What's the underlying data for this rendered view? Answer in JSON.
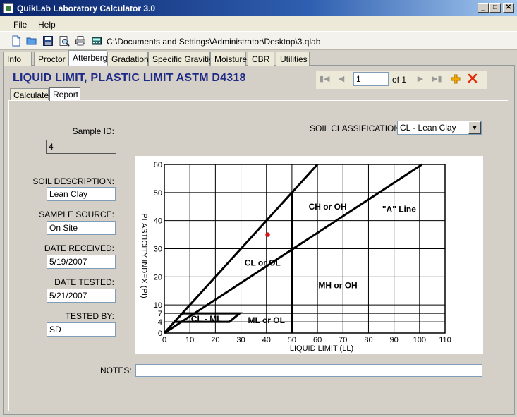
{
  "window": {
    "title": "QuikLab Laboratory Calculator 3.0",
    "minimize": "_",
    "maximize": "□",
    "close": "✕"
  },
  "menu": [
    "File",
    "Help"
  ],
  "toolbar": {
    "icons": [
      "new-file-icon",
      "open-folder-icon",
      "save-icon",
      "print-preview-icon",
      "print-icon",
      "calculator-icon"
    ],
    "file_path": "C:\\Documents and Settings\\Administrator\\Desktop\\3.qlab"
  },
  "tabs": [
    "Info",
    "Proctor",
    "Atterberg",
    "Gradation",
    "Specific Gravitiy",
    "Moisture",
    "CBR",
    "Utilities"
  ],
  "active_tab": "Atterberg",
  "page_title": "LIQUID LIMIT, PLASTIC LIMIT ASTM D4318",
  "navigator": {
    "record": "1",
    "of_text": "of 1"
  },
  "subtabs": [
    "Calculate",
    "Report"
  ],
  "active_subtab": "Report",
  "form": {
    "sample_id_label": "Sample ID:",
    "sample_id": "4",
    "soil_classification_label": "SOIL CLASSIFICATION:",
    "soil_classification": "CL - Lean Clay",
    "soil_description_label": "SOIL DESCRIPTION:",
    "soil_description": "Lean Clay",
    "sample_source_label": "SAMPLE SOURCE:",
    "sample_source": "On Site",
    "date_received_label": "DATE RECEIVED:",
    "date_received": "5/19/2007",
    "date_tested_label": "DATE TESTED:",
    "date_tested": "5/21/2007",
    "tested_by_label": "TESTED BY:",
    "tested_by": "SD",
    "notes_label": "NOTES:",
    "notes": ""
  },
  "colors": {
    "accent": "#1f2a87",
    "data_point": "#e01010",
    "add": "#f0a800",
    "delete": "#e03010"
  },
  "chart_data": {
    "type": "scatter",
    "title": "",
    "xlabel": "LIQUID LIMIT (LL)",
    "ylabel": "PLASTICITY INDEX (PI)",
    "xlim": [
      0,
      110
    ],
    "ylim": [
      0,
      60
    ],
    "x_ticks": [
      0,
      10,
      20,
      30,
      40,
      50,
      60,
      70,
      80,
      90,
      100,
      110
    ],
    "y_ticks": [
      0,
      4,
      7,
      10,
      20,
      30,
      40,
      50,
      60
    ],
    "grid": true,
    "points": [
      {
        "x": 40.5,
        "y": 35
      }
    ],
    "lines": {
      "u_line": [
        [
          0,
          0
        ],
        [
          60,
          60
        ]
      ],
      "a_line": [
        [
          0,
          0
        ],
        [
          101,
          60
        ]
      ],
      "ll_50": [
        [
          50,
          0
        ],
        [
          50,
          50
        ]
      ],
      "cl_ml_zone": [
        [
          4,
          4
        ],
        [
          25.5,
          4
        ],
        [
          29.5,
          7
        ],
        [
          7,
          7
        ]
      ]
    },
    "annotations": [
      {
        "text": "CH or OH",
        "x": 64,
        "y": 45
      },
      {
        "text": "\"A\" Line",
        "x": 92,
        "y": 44
      },
      {
        "text": "CL or OL",
        "x": 38.5,
        "y": 25
      },
      {
        "text": "MH or OH",
        "x": 68,
        "y": 17
      },
      {
        "text": "CL - ML",
        "x": 16.5,
        "y": 5
      },
      {
        "text": "ML or OL",
        "x": 40,
        "y": 4.5
      }
    ]
  }
}
